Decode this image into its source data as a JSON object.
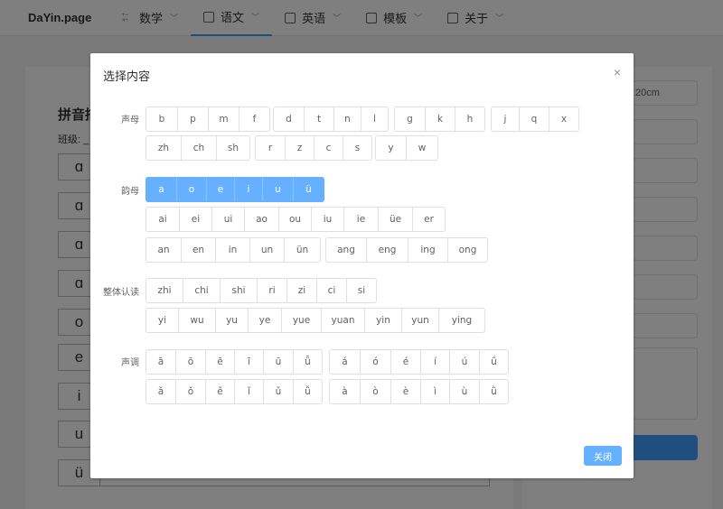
{
  "nav": {
    "brand": "DaYin.page",
    "items": [
      {
        "label": "数学",
        "icon": "math-icon"
      },
      {
        "label": "语文",
        "icon": "chinese-icon"
      },
      {
        "label": "英语",
        "icon": "english-icon"
      },
      {
        "label": "模板",
        "icon": "template-icon"
      },
      {
        "label": "关于",
        "icon": "chat-icon"
      }
    ],
    "active_index": 1
  },
  "page": {
    "title": "拼音描",
    "class_label": "班级: _",
    "row_letters": [
      "ɑ",
      "ɑ",
      "ɑ",
      "ɑ",
      "o",
      "e",
      "i",
      "u",
      "ü"
    ],
    "size_value": "20cm"
  },
  "dialog": {
    "title": "选择内容",
    "close_icon": "close-icon",
    "close_label": "关闭",
    "sections": {
      "initials": "声母",
      "finals": "韵母",
      "whole": "整体认读",
      "tones": "声调"
    },
    "groups": {
      "initials_g1": [
        "b",
        "p",
        "m",
        "f"
      ],
      "initials_g2": [
        "d",
        "t",
        "n",
        "l"
      ],
      "initials_g3": [
        "g",
        "k",
        "h"
      ],
      "initials_g4": [
        "j",
        "q",
        "x"
      ],
      "initials_g5": [
        "zh",
        "ch",
        "sh"
      ],
      "initials_g6": [
        "r",
        "z",
        "c",
        "s"
      ],
      "initials_g7": [
        "y",
        "w"
      ],
      "finals_g1": [
        "a",
        "o",
        "e",
        "i",
        "u",
        "ü"
      ],
      "finals_g2": [
        "ai",
        "ei",
        "ui",
        "ao",
        "ou",
        "iu",
        "ie",
        "üe",
        "er"
      ],
      "finals_g3": [
        "an",
        "en",
        "in",
        "un",
        "ün"
      ],
      "finals_g4": [
        "ang",
        "eng",
        "ing",
        "ong"
      ],
      "whole_g1": [
        "zhi",
        "chi",
        "shi",
        "ri",
        "zi",
        "ci",
        "si"
      ],
      "whole_g2": [
        "yi",
        "wu",
        "yu",
        "ye",
        "yue",
        "yuan",
        "yin",
        "yun",
        "ying"
      ],
      "tones_g1": [
        "ā",
        "ō",
        "ē",
        "ī",
        "ū",
        "ǖ"
      ],
      "tones_g2": [
        "á",
        "ó",
        "é",
        "í",
        "ú",
        "ǘ"
      ],
      "tones_g3": [
        "ǎ",
        "ǒ",
        "ě",
        "ǐ",
        "ǔ",
        "ǚ"
      ],
      "tones_g4": [
        "à",
        "ò",
        "è",
        "ì",
        "ù",
        "ǜ"
      ]
    },
    "selected_group": "finals_g1",
    "colors": {
      "primary": "#66b1ff",
      "border": "#dcdfe6"
    }
  }
}
